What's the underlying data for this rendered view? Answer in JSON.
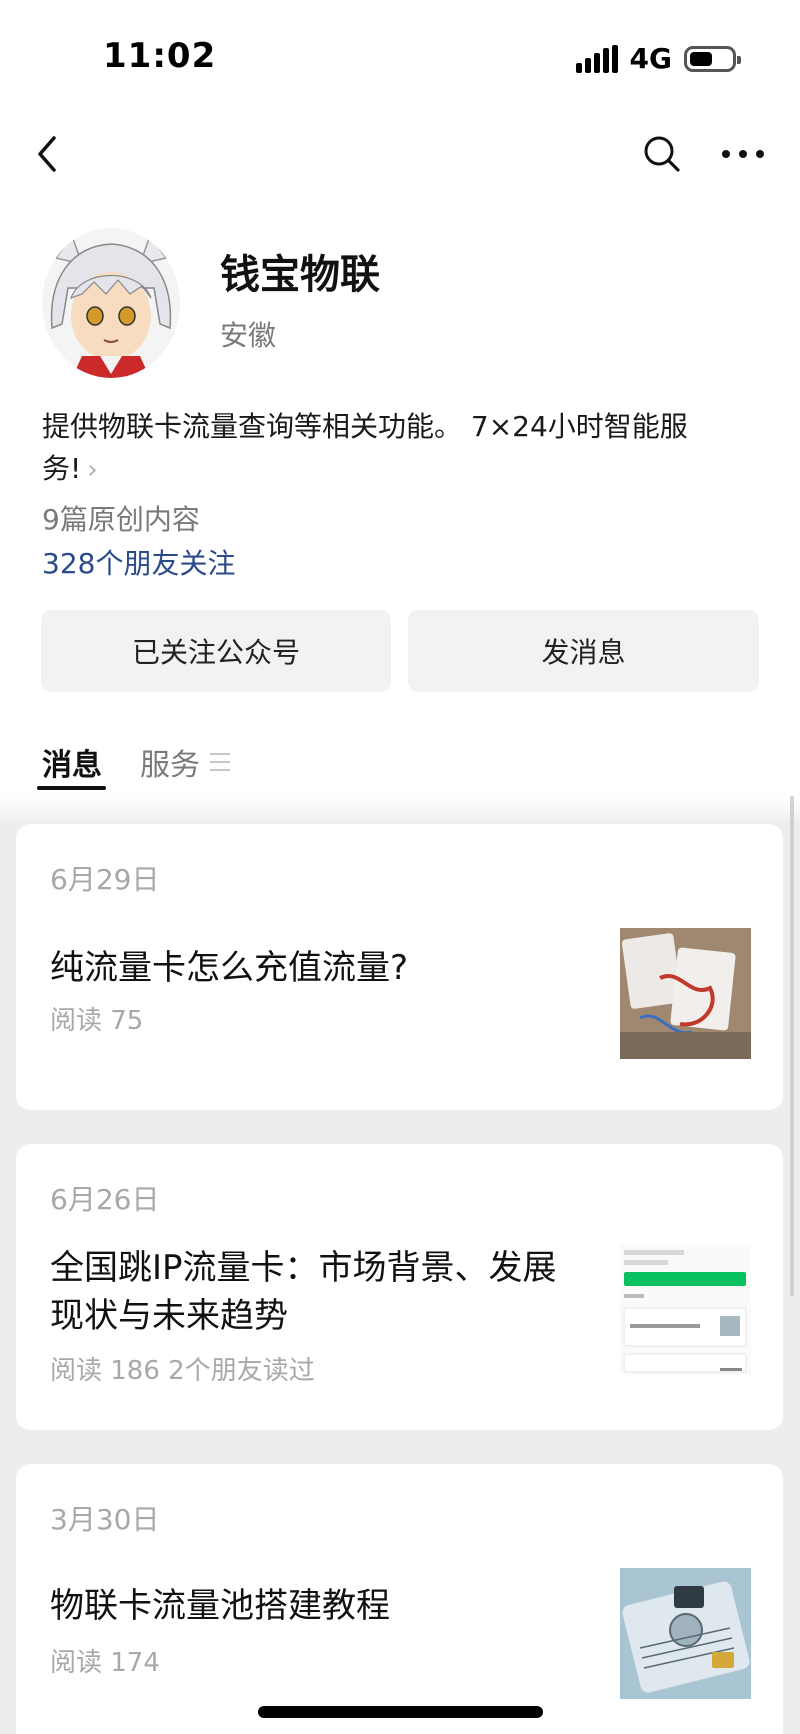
{
  "status_bar": {
    "time": "11:02",
    "network": "4G",
    "battery_level": 0.55,
    "icons": [
      "signal-icon",
      "battery-icon"
    ]
  },
  "nav": {
    "icons": [
      "back-icon",
      "search-icon",
      "more-icon"
    ]
  },
  "profile": {
    "name": "钱宝物联",
    "region": "安徽",
    "description": "提供物联卡流量查询等相关功能。 7×24小时智能服务!",
    "original_count": "9篇原创内容",
    "friends_following": "328个朋友关注"
  },
  "actions": {
    "follow_label": "已关注公众号",
    "message_label": "发消息"
  },
  "tabs": [
    {
      "label": "消息",
      "active": true
    },
    {
      "label": "服务",
      "active": false
    }
  ],
  "articles": [
    {
      "date": "6月29日",
      "title": "纯流量卡怎么充值流量?",
      "meta": "阅读 75"
    },
    {
      "date": "6月26日",
      "title": "全国跳IP流量卡：市场背景、发展现状与未来趋势",
      "meta": "阅读 186  2个朋友读过"
    },
    {
      "date": "3月30日",
      "title": "物联卡流量池搭建教程",
      "meta": "阅读 174"
    }
  ],
  "colors": {
    "accent_link": "#2a4a8a",
    "wechat_green": "#07c160",
    "feed_background": "#ededed"
  }
}
